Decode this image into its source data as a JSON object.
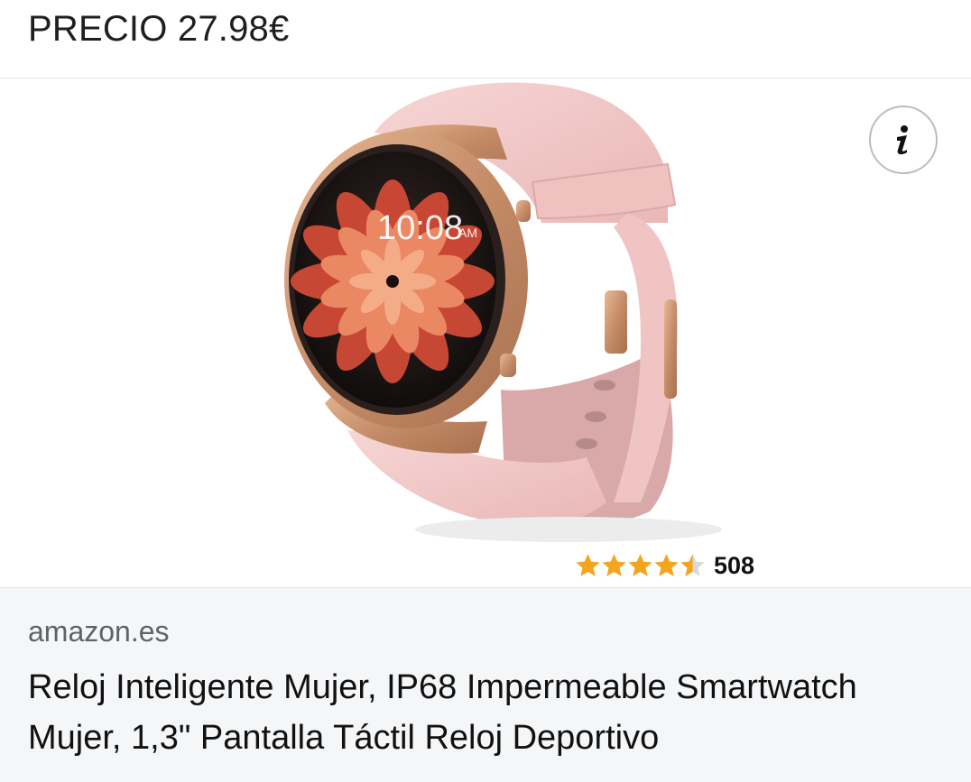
{
  "header": {
    "price_label": "PRECIO 27.98€"
  },
  "ad": {
    "product_image": "pink-smartwatch-image",
    "watch_face_time": "10:08",
    "watch_face_ampm": "AM",
    "info_icon": "info-icon",
    "rating": {
      "stars": 4.5,
      "max_stars": 5,
      "review_count": "508"
    },
    "source_domain": "amazon.es",
    "title": "Reloj Inteligente Mujer, IP68 Impermeable Smartwatch Mujer, 1,3\" Pantalla Táctil Reloj Deportivo"
  },
  "colors": {
    "star_fill": "#f4a41d",
    "strap_pink": "#f1c8c8",
    "case_gold": "#c9926c",
    "caption_background": "#f5f6f8"
  }
}
